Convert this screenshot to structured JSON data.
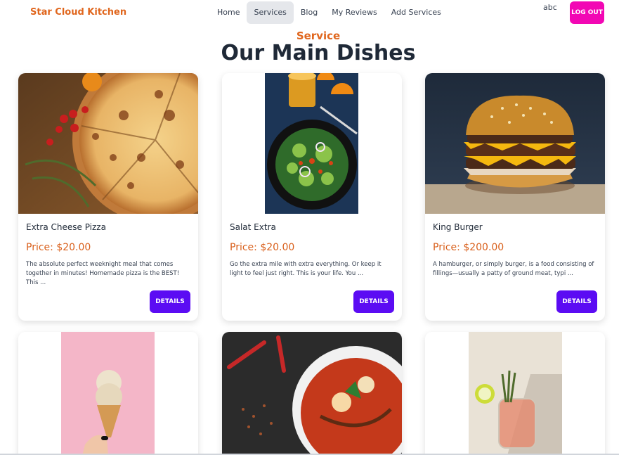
{
  "brand": "Star Cloud Kitchen",
  "nav": [
    {
      "label": "Home",
      "active": false
    },
    {
      "label": "Services",
      "active": true
    },
    {
      "label": "Blog",
      "active": false
    },
    {
      "label": "My Reviews",
      "active": false
    },
    {
      "label": "Add Services",
      "active": false
    }
  ],
  "user": {
    "name": "abc",
    "logout_label": "LOG OUT"
  },
  "section_label": "Service",
  "page_title": "Our Main Dishes",
  "colors": {
    "brand": "#e0661d",
    "logout": "#f207b4",
    "details": "#5b0cf3",
    "price": "#d9601c"
  },
  "services": [
    {
      "title": "Extra Cheese Pizza",
      "price": "Price: $20.00",
      "description": "The absolute perfect weeknight meal that comes together in minutes! Homemade pizza is the BEST! This ...",
      "button": "DETAILS",
      "image": "pizza-photo"
    },
    {
      "title": "Salat Extra",
      "price": "Price: $20.00",
      "description": "Go the extra mile with extra everything. Or keep it light to feel just right. This is your life. You ...",
      "button": "DETAILS",
      "image": "salad-photo"
    },
    {
      "title": "King Burger",
      "price": "Price: $200.00",
      "description": "A hamburger, or simply burger, is a food consisting of fillings—usually a patty of ground meat, typi ...",
      "button": "DETAILS",
      "image": "burger-photo"
    },
    {
      "image": "ice-cream-photo"
    },
    {
      "image": "curry-photo"
    },
    {
      "image": "cocktail-photo"
    }
  ]
}
